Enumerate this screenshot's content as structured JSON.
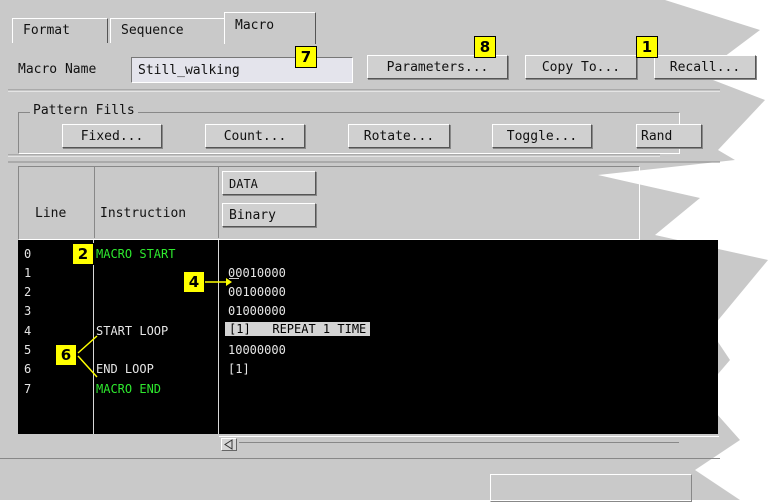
{
  "tabs": [
    {
      "label": "Format",
      "active": false
    },
    {
      "label": "Sequence",
      "active": false
    },
    {
      "label": "Macro",
      "active": true
    }
  ],
  "macro": {
    "name_label": "Macro Name",
    "name_value": "Still_walking",
    "buttons": {
      "parameters": "Parameters...",
      "copy_to": "Copy To...",
      "recall": "Recall..."
    }
  },
  "pattern_fills": {
    "legend": "Pattern Fills",
    "buttons": [
      "Fixed...",
      "Count...",
      "Rotate...",
      "Toggle...",
      "Rand"
    ]
  },
  "table": {
    "header_line": "Line",
    "header_instruction": "Instruction",
    "data_label": "DATA",
    "radix_label": "Binary",
    "line_numbers": [
      "0",
      "1",
      "2",
      "3",
      "4",
      "5",
      "6",
      "7"
    ],
    "instructions": [
      {
        "text": "MACRO START",
        "color": "#2ee82e"
      },
      {
        "text": "",
        "color": "#e6e6e6"
      },
      {
        "text": "",
        "color": "#e6e6e6"
      },
      {
        "text": "",
        "color": "#e6e6e6"
      },
      {
        "text": "START LOOP",
        "color": "#e6e6e6"
      },
      {
        "text": "",
        "color": "#e6e6e6"
      },
      {
        "text": "END LOOP",
        "color": "#e6e6e6"
      },
      {
        "text": "MACRO END",
        "color": "#2ee82e"
      }
    ],
    "data_values": [
      "",
      "00010000",
      "00100000",
      "01000000",
      "[1]   REPEAT 1 TIME",
      "10000000",
      "[1]",
      ""
    ]
  },
  "callouts": [
    "1",
    "2",
    "4",
    "6",
    "7",
    "8"
  ],
  "colors": {
    "panel": "#c9c9c9",
    "listing_bg": "#000000",
    "green_text": "#2ee82e",
    "callout": "#ffff00"
  }
}
